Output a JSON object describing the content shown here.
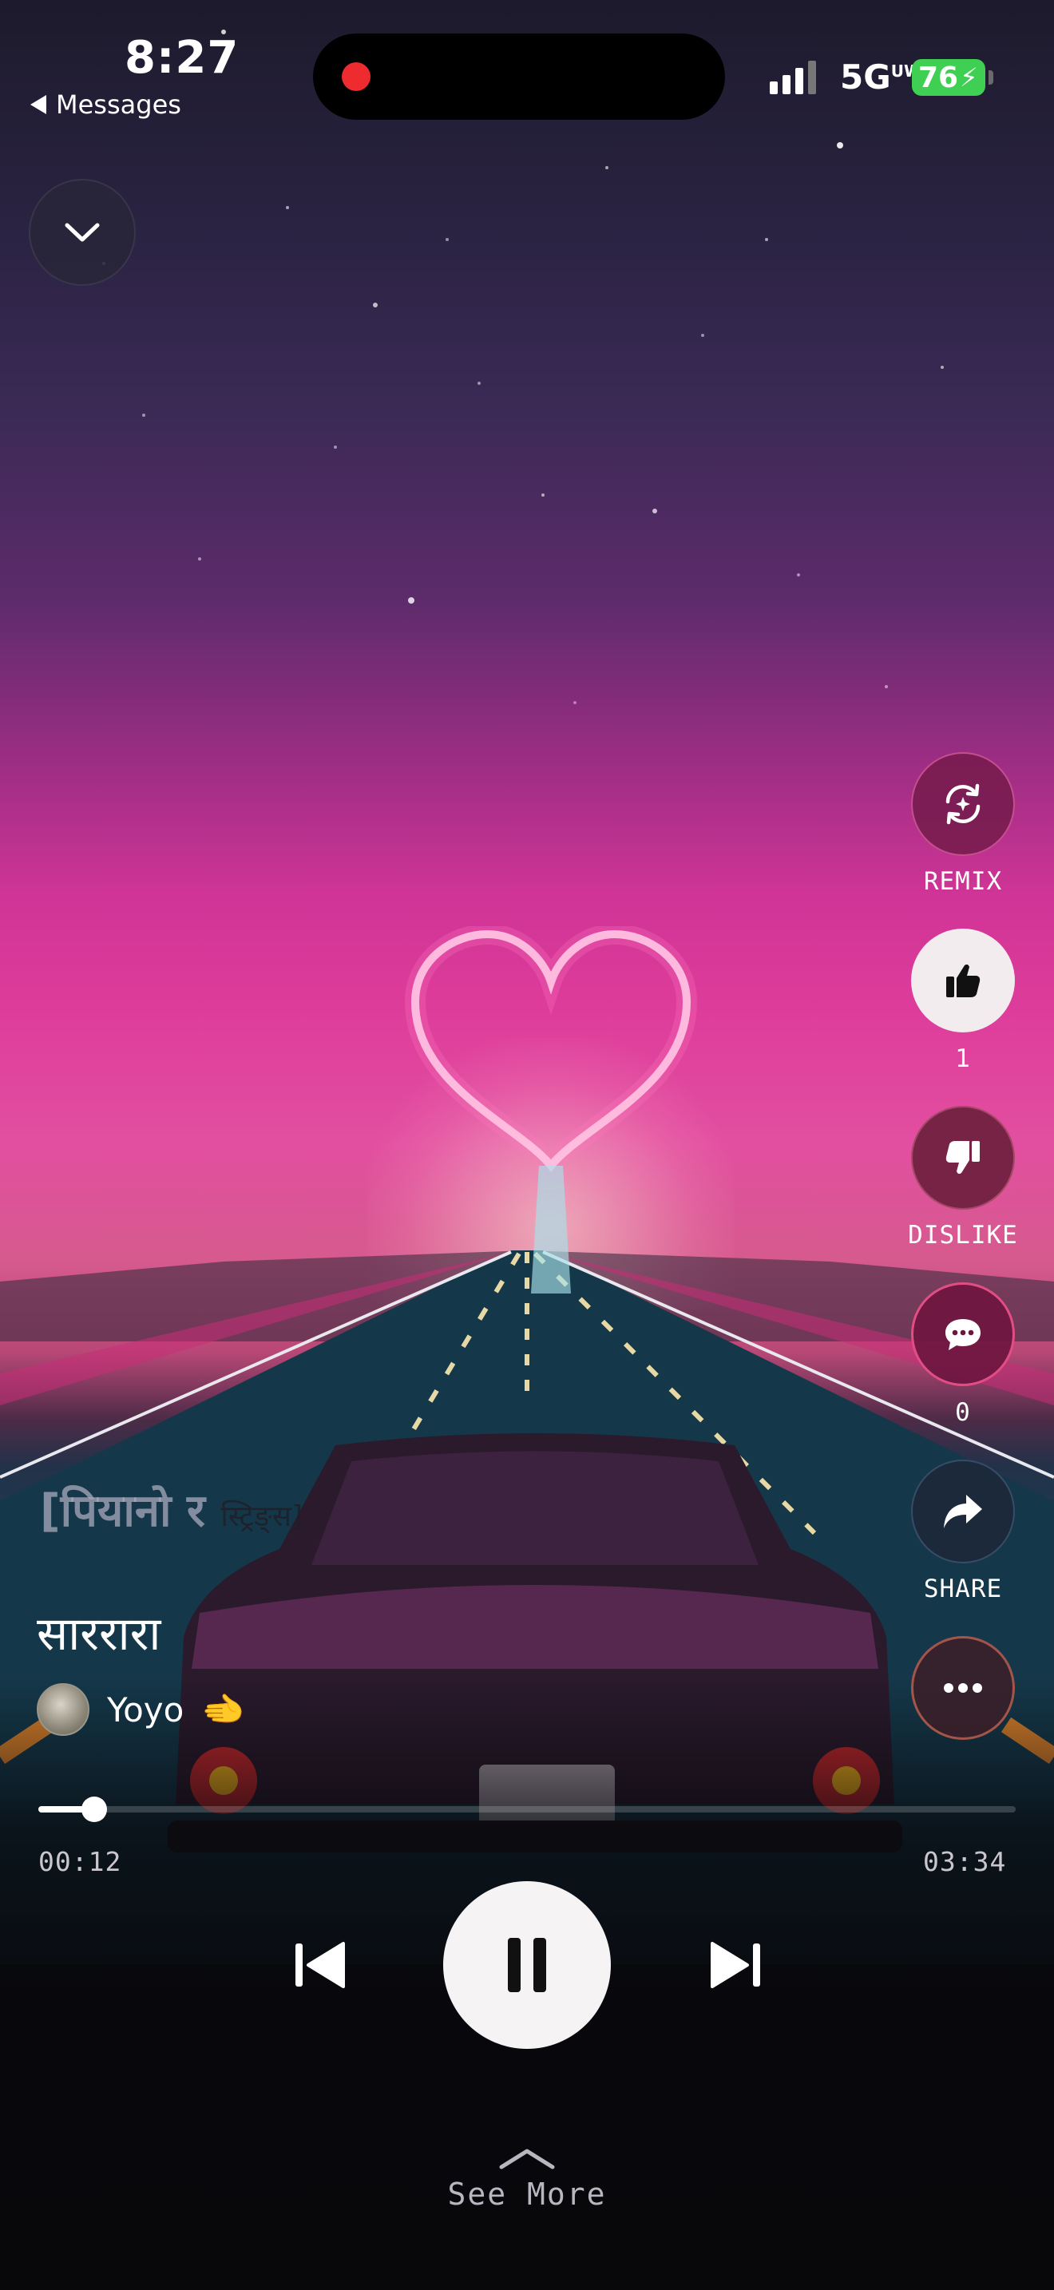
{
  "status_bar": {
    "time": "8:27",
    "back_label": "Messages",
    "network": "5G",
    "network_suffix": "UW",
    "battery": "76"
  },
  "actions": {
    "remix_label": "REMIX",
    "like_count": "1",
    "dislike_label": "DISLIKE",
    "comment_count": "0",
    "share_label": "SHARE"
  },
  "song": {
    "lyric_main": "[पियानो र",
    "lyric_small": "स्ट्रिङ्स]",
    "title": "साररारा",
    "artist": "Yoyo",
    "artist_emoji": "🫲"
  },
  "player": {
    "current_time": "00:12",
    "total_time": "03:34",
    "progress": 0.057
  },
  "footer": {
    "see_more": "See More"
  },
  "colors": {
    "accent_pink": "#de3c9b",
    "record_dot": "#ee2b2e",
    "battery_green": "#3fcf52"
  }
}
